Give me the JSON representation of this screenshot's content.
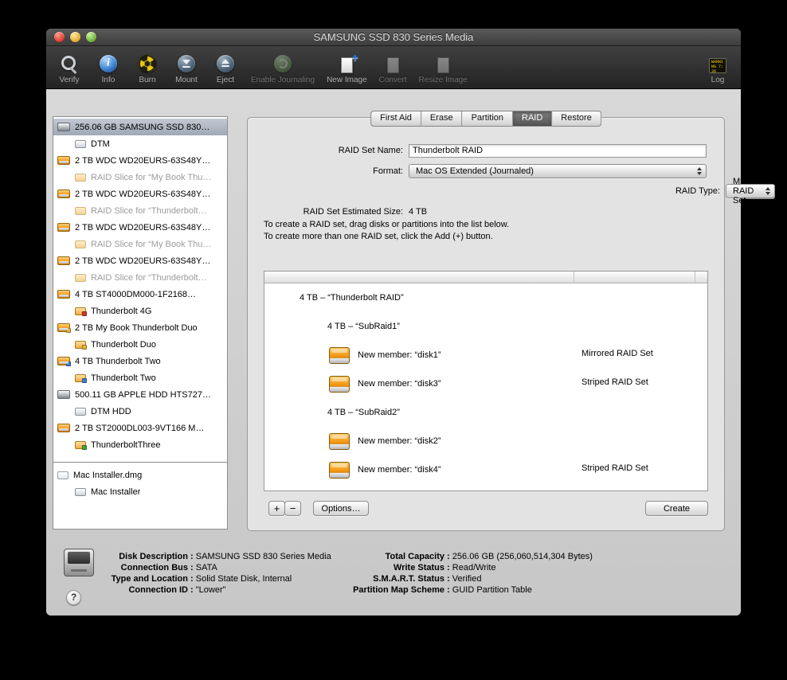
{
  "window": {
    "title": "SAMSUNG SSD 830 Series Media"
  },
  "colors": {
    "disk_orange": "#f0940d",
    "selection_gray": "#a8b1bd",
    "active_tab": "#5c5c5c",
    "traffic_red": "#e0443a",
    "traffic_yellow": "#e8b33a",
    "traffic_green": "#78b643"
  },
  "toolbar": {
    "items": [
      {
        "label": "Verify",
        "icon": "verify-icon",
        "enabled": true
      },
      {
        "label": "Info",
        "icon": "info-icon",
        "enabled": true
      },
      {
        "label": "Burn",
        "icon": "burn-icon",
        "enabled": true
      },
      {
        "label": "Mount",
        "icon": "mount-icon",
        "enabled": true
      },
      {
        "label": "Eject",
        "icon": "eject-icon",
        "enabled": true
      },
      {
        "label": "Enable Journaling",
        "icon": "journaling-icon",
        "enabled": false
      },
      {
        "label": "New Image",
        "icon": "new-image-icon",
        "enabled": true
      },
      {
        "label": "Convert",
        "icon": "convert-icon",
        "enabled": false
      },
      {
        "label": "Resize Image",
        "icon": "resize-image-icon",
        "enabled": false
      }
    ],
    "log": {
      "label": "Log",
      "icon_text": "WARNING 7:36"
    }
  },
  "sidebar": {
    "items": [
      {
        "label": "256.06 GB SAMSUNG SSD 830…",
        "indent": 0,
        "icon": "disk-gray",
        "selected": true
      },
      {
        "label": "DTM",
        "indent": 1,
        "icon": "volume-gray"
      },
      {
        "label": "2 TB WDC WD20EURS-63S48Y…",
        "indent": 0,
        "icon": "disk-orange"
      },
      {
        "label": "RAID Slice for “My Book Thu…",
        "indent": 1,
        "icon": "volume-orange",
        "dimmed": true
      },
      {
        "label": "2 TB WDC WD20EURS-63S48Y…",
        "indent": 0,
        "icon": "disk-orange"
      },
      {
        "label": "RAID Slice for “Thunderbolt…",
        "indent": 1,
        "icon": "volume-orange",
        "dimmed": true
      },
      {
        "label": "2 TB WDC WD20EURS-63S48Y…",
        "indent": 0,
        "icon": "disk-orange"
      },
      {
        "label": "RAID Slice for “My Book Thu…",
        "indent": 1,
        "icon": "volume-orange",
        "dimmed": true
      },
      {
        "label": "2 TB WDC WD20EURS-63S48Y…",
        "indent": 0,
        "icon": "disk-orange"
      },
      {
        "label": "RAID Slice for “Thunderbolt…",
        "indent": 1,
        "icon": "volume-orange",
        "dimmed": true
      },
      {
        "label": "4 TB ST4000DM000-1F2168…",
        "indent": 0,
        "icon": "disk-orange"
      },
      {
        "label": "Thunderbolt 4G",
        "indent": 1,
        "icon": "volume-orange",
        "badge": "#cc3a30"
      },
      {
        "label": "2 TB My Book Thunderbolt Duo",
        "indent": 0,
        "icon": "disk-orange",
        "badge": "#e8b33a"
      },
      {
        "label": "Thunderbolt Duo",
        "indent": 1,
        "icon": "volume-orange",
        "badge": "#e8b33a"
      },
      {
        "label": "4 TB Thunderbolt Two",
        "indent": 0,
        "icon": "disk-orange",
        "badge": "#3f7fd4"
      },
      {
        "label": "Thunderbolt Two",
        "indent": 1,
        "icon": "volume-orange",
        "badge": "#3f7fd4"
      },
      {
        "label": "500.11 GB APPLE HDD HTS727…",
        "indent": 0,
        "icon": "disk-gray"
      },
      {
        "label": "DTM HDD",
        "indent": 1,
        "icon": "volume-gray"
      },
      {
        "label": "2 TB ST2000DL003-9VT166 M…",
        "indent": 0,
        "icon": "disk-orange"
      },
      {
        "label": "ThunderboltThree",
        "indent": 1,
        "icon": "volume-orange",
        "badge": "#45a33c"
      },
      {
        "separator": true
      },
      {
        "label": "Mac Installer.dmg",
        "indent": 0,
        "icon": "dmg"
      },
      {
        "label": "Mac Installer",
        "indent": 1,
        "icon": "volume-gray"
      }
    ]
  },
  "tabs": {
    "items": [
      "First Aid",
      "Erase",
      "Partition",
      "RAID",
      "Restore"
    ],
    "active": "RAID"
  },
  "raid_form": {
    "name_label": "RAID Set Name:",
    "name_value": "Thunderbolt RAID",
    "format_label": "Format:",
    "format_value": "Mac OS Extended (Journaled)",
    "type_label": "RAID Type:",
    "type_value": "Mirrored RAID Set",
    "size_label": "RAID Set Estimated Size:",
    "size_value": "4 TB",
    "instructions": [
      "To create a RAID set, drag disks or partitions into the list below.",
      "To create more than one RAID set, click the Add (+) button."
    ]
  },
  "raid_table": {
    "rows": [
      {
        "label": "4 TB – “Thunderbolt RAID”",
        "type": "Mirrored RAID Set",
        "level": 1,
        "icon": false
      },
      {
        "label": "4 TB – “SubRaid1”",
        "type": "Striped RAID Set",
        "level": 2,
        "icon": false
      },
      {
        "label": "New member: “disk1”",
        "type": "",
        "level": 3,
        "icon": true
      },
      {
        "label": "New member: “disk3”",
        "type": "",
        "level": 3,
        "icon": true
      },
      {
        "label": "4 TB – “SubRaid2”",
        "type": "Striped RAID Set",
        "level": 2,
        "icon": false
      },
      {
        "label": "New member: “disk2”",
        "type": "",
        "level": 3,
        "icon": true
      },
      {
        "label": "New member: “disk4”",
        "type": "",
        "level": 3,
        "icon": true
      }
    ]
  },
  "actions": {
    "add": "+",
    "remove": "−",
    "options": "Options…",
    "create": "Create"
  },
  "help": {
    "label": "?"
  },
  "info": {
    "left": [
      {
        "label": "Disk Description",
        "value": "SAMSUNG SSD 830 Series Media"
      },
      {
        "label": "Connection Bus",
        "value": "SATA"
      },
      {
        "label": "Type and Location",
        "value": "Solid State Disk, Internal"
      },
      {
        "label": "Connection ID",
        "value": "\"Lower\""
      }
    ],
    "right": [
      {
        "label": "Total Capacity",
        "value": "256.06 GB (256,060,514,304 Bytes)"
      },
      {
        "label": "Write Status",
        "value": "Read/Write"
      },
      {
        "label": "S.M.A.R.T. Status",
        "value": "Verified"
      },
      {
        "label": "Partition Map Scheme",
        "value": "GUID Partition Table"
      }
    ]
  }
}
